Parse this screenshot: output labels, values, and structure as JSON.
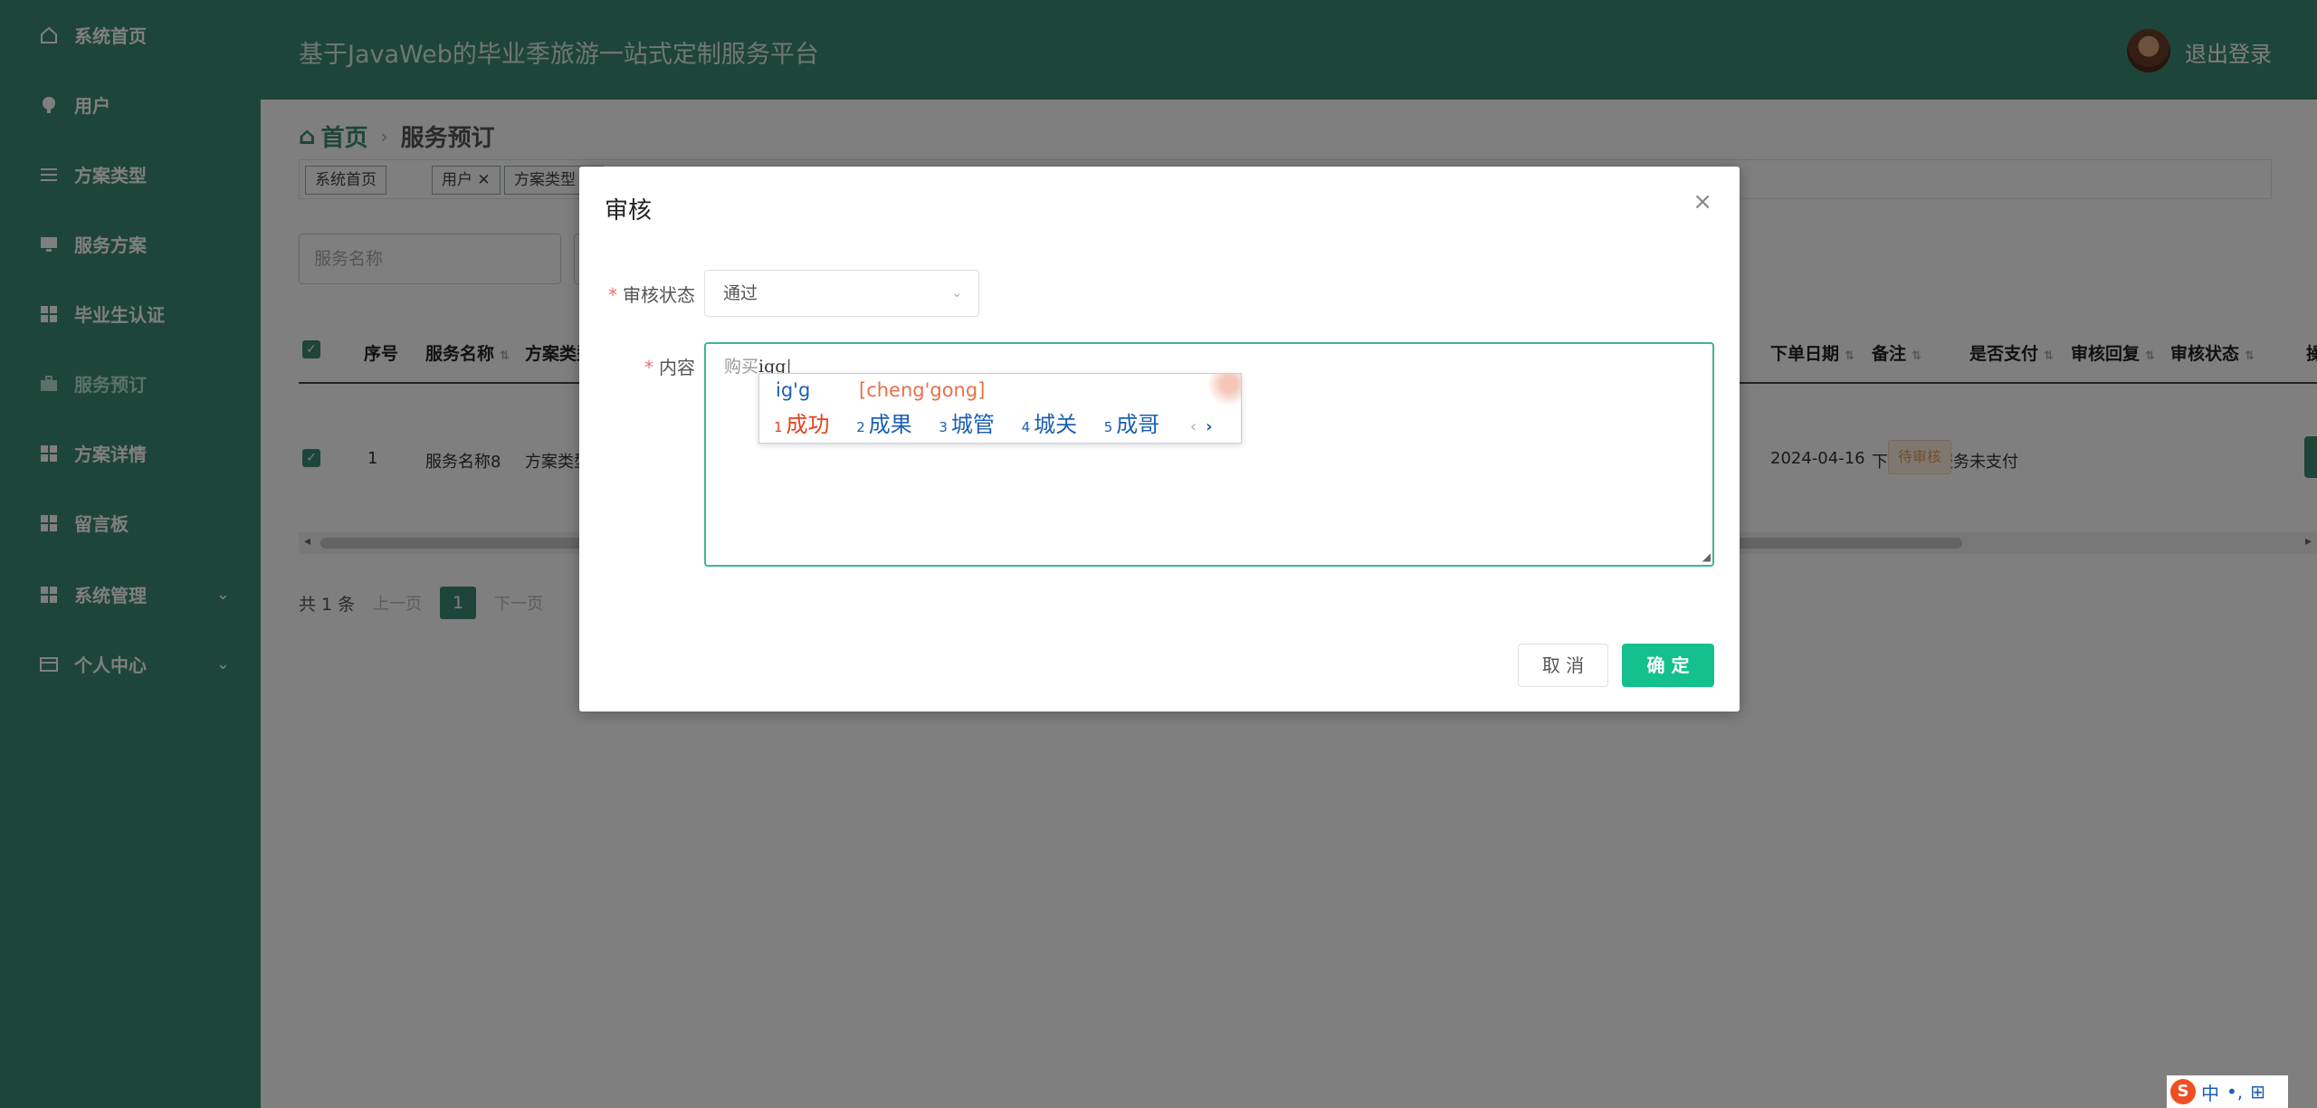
{
  "sidebar": {
    "items": [
      {
        "label": "系统首页",
        "icon": "home-icon"
      },
      {
        "label": "用户",
        "icon": "location-pin-icon"
      },
      {
        "label": "方案类型",
        "icon": "list-icon"
      },
      {
        "label": "服务方案",
        "icon": "monitor-icon"
      },
      {
        "label": "毕业生认证",
        "icon": "grid-icon"
      },
      {
        "label": "服务预订",
        "icon": "briefcase-icon",
        "active": true
      },
      {
        "label": "方案详情",
        "icon": "grid-icon"
      },
      {
        "label": "留言板",
        "icon": "grid-icon"
      },
      {
        "label": "系统管理",
        "icon": "grid-icon",
        "expandable": true
      },
      {
        "label": "个人中心",
        "icon": "card-icon",
        "expandable": true
      }
    ]
  },
  "header": {
    "title": "基于JavaWeb的毕业季旅游一站式定制服务平台",
    "logout": "退出登录"
  },
  "breadcrumb": {
    "home": "首页",
    "current": "服务预订"
  },
  "tags": [
    "系统首页",
    "用户 ✕",
    "方案类型 ✕"
  ],
  "search": {
    "placeholder": "服务名称"
  },
  "table": {
    "headers": {
      "index": "序号",
      "service_name": "服务名称",
      "plan_type": "方案类型",
      "order_date": "下单日期",
      "remark": "备注",
      "paid": "是否支付",
      "review_reply": "审核回复",
      "review_status": "审核状态",
      "op": "操"
    },
    "rows": [
      {
        "index": "1",
        "service_name": "服务名称8",
        "plan_type": "方案类型",
        "order_date": "2024-04-16",
        "remark": "下单购买服务",
        "paid": "未支付",
        "review_status": "待审核"
      }
    ]
  },
  "pager": {
    "total": "共 1 条",
    "prev": "上一页",
    "page": "1",
    "next": "下一页"
  },
  "dialog": {
    "title": "审核",
    "status_label": "审核状态",
    "status_value": "通过",
    "content_label": "内容",
    "content_prefix": "购买",
    "content_typed": "igg",
    "cancel": "取 消",
    "confirm": "确 定"
  },
  "ime": {
    "composition": "ig'g",
    "pinyin": "[cheng'gong]",
    "candidates": [
      {
        "num": "1",
        "text": "成功"
      },
      {
        "num": "2",
        "text": "成果"
      },
      {
        "num": "3",
        "text": "城管"
      },
      {
        "num": "4",
        "text": "城关"
      },
      {
        "num": "5",
        "text": "成哥"
      }
    ],
    "prev": "‹",
    "next": "›"
  },
  "tray": {
    "logo": "S",
    "mode": "中",
    "punct": "•,",
    "extra": "⊞"
  },
  "colors": {
    "sidebar": "#3d8a72",
    "accent": "#13c08e",
    "pending": "#e8a050"
  }
}
